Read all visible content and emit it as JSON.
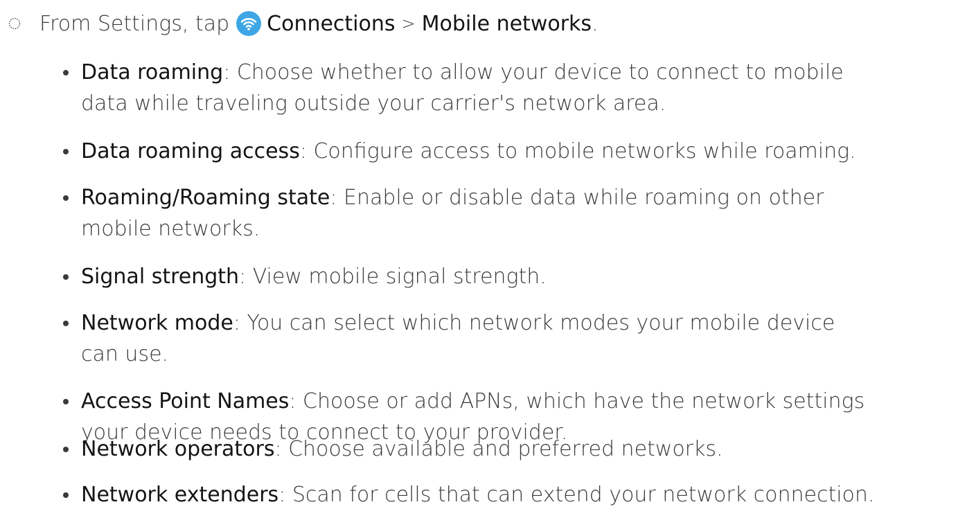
{
  "step": {
    "prefix": "From Settings, tap",
    "icon": "wifi-icon",
    "link1": "Connections",
    "separator": ">",
    "link2": "Mobile networks",
    "suffix": "."
  },
  "bullets": [
    {
      "term": "Data roaming",
      "line1": ": Choose whether to allow your device to connect to mobile",
      "line2": "data while traveling outside your carrier's network area."
    },
    {
      "term": "Data roaming access",
      "line1": ": Configure access to mobile networks while roaming.",
      "line2": ""
    },
    {
      "term": "Roaming/Roaming state",
      "line1": ": Enable or disable data while roaming on other",
      "line2": "mobile networks."
    },
    {
      "term": "Signal strength",
      "line1": ": View mobile signal strength.",
      "line2": ""
    },
    {
      "term": "Network mode",
      "line1": ": You can select which network modes your mobile device",
      "line2": "can use."
    },
    {
      "term": "Access Point Names",
      "line1": ": Choose or add APNs, which have the network settings",
      "line2": "your device needs to connect to your provider."
    },
    {
      "term": "Network operators",
      "line1": ": Choose available and preferred networks.",
      "line2": ""
    },
    {
      "term": "Network extenders",
      "line1": ": Scan for cells that can extend your network connection.",
      "line2": ""
    }
  ],
  "colors": {
    "icon_background": "#3fa6e6",
    "text": "#3a3a3a",
    "term": "#141414"
  }
}
